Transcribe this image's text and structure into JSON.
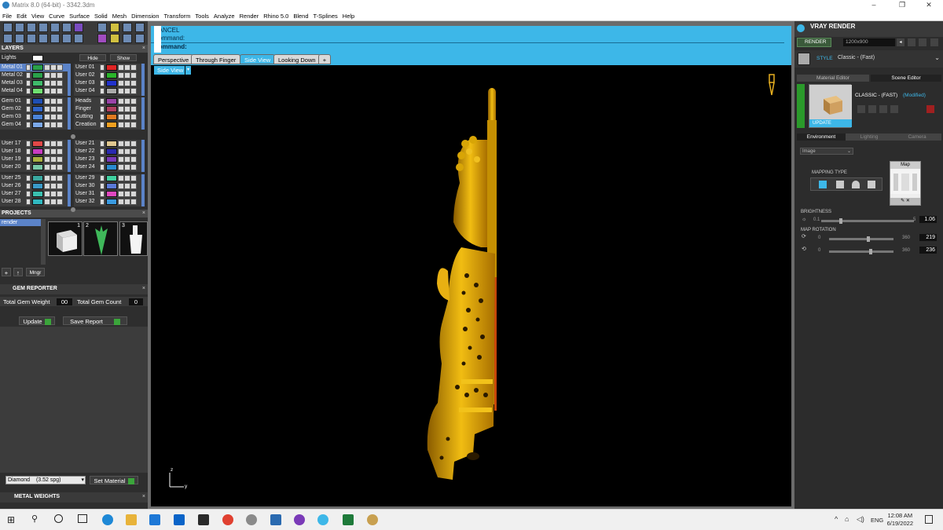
{
  "window": {
    "title": "Matrix 8.0 (64-bit) - 3342.3dm",
    "min": "–",
    "max": "❐",
    "close": "✕"
  },
  "menu": [
    "File",
    "Edit",
    "View",
    "Curve",
    "Surface",
    "Solid",
    "Mesh",
    "Dimension",
    "Transform",
    "Tools",
    "Analyze",
    "Render",
    "Rhino 5.0",
    "Blend",
    "T-Splines",
    "Help"
  ],
  "layers": {
    "header": "LAYERS",
    "lights": "Lights",
    "hide": "Hide",
    "show": "Show",
    "metals": [
      {
        "name": "Metal 01",
        "color": "#2aa04a"
      },
      {
        "name": "Metal 02",
        "color": "#2aa04a"
      },
      {
        "name": "Metal 03",
        "color": "#3fba6a"
      },
      {
        "name": "Metal 04",
        "color": "#6fe070"
      }
    ],
    "users_a": [
      {
        "name": "User 01",
        "color": "#e02424"
      },
      {
        "name": "User 02",
        "color": "#2ab52a"
      },
      {
        "name": "User 03",
        "color": "#2233cc"
      },
      {
        "name": "User 04",
        "color": "#aaaaaa"
      }
    ],
    "gems": [
      {
        "name": "Gem 01",
        "color": "#1f4fb5"
      },
      {
        "name": "Gem 02",
        "color": "#2f64c8"
      },
      {
        "name": "Gem 03",
        "color": "#4b84d8"
      },
      {
        "name": "Gem 04",
        "color": "#7ba8e8"
      }
    ],
    "misc": [
      {
        "name": "Heads",
        "color": "#9a44a8"
      },
      {
        "name": "Finger",
        "color": "#b04060"
      },
      {
        "name": "Cutting",
        "color": "#e07a20"
      },
      {
        "name": "Creation",
        "color": "#f0a020"
      }
    ],
    "users_b": [
      {
        "name": "User 17",
        "color": "#e04848"
      },
      {
        "name": "User 18",
        "color": "#c83cc0"
      },
      {
        "name": "User 19",
        "color": "#a8b040"
      },
      {
        "name": "User 20",
        "color": "#78c8a8"
      }
    ],
    "users_c": [
      {
        "name": "User 21",
        "color": "#e0c890"
      },
      {
        "name": "User 22",
        "color": "#2a2ab0"
      },
      {
        "name": "User 23",
        "color": "#7a3ab8"
      },
      {
        "name": "User 24",
        "color": "#2a8ad0"
      }
    ],
    "users_d": [
      {
        "name": "User 25",
        "color": "#3aa8a0"
      },
      {
        "name": "User 26",
        "color": "#3a9ac8"
      },
      {
        "name": "User 27",
        "color": "#3ac0b0"
      },
      {
        "name": "User 28",
        "color": "#30b8c0"
      }
    ],
    "users_e": [
      {
        "name": "User 29",
        "color": "#40d0a0"
      },
      {
        "name": "User 30",
        "color": "#5a7ad8"
      },
      {
        "name": "User 31",
        "color": "#e048c0"
      },
      {
        "name": "User 32",
        "color": "#3a9ae0"
      }
    ]
  },
  "projects": {
    "header": "PROJECTS",
    "item": "render",
    "thumbs": [
      "1",
      "2",
      "3"
    ],
    "mngr": "Mngr"
  },
  "gem_reporter": {
    "header": "GEM REPORTER",
    "total_weight_label": "Total Gem Weight",
    "total_weight_value": "00",
    "total_count_label": "Total Gem Count",
    "total_count_value": "0",
    "update": "Update",
    "save_report": "Save Report",
    "material": "Diamond",
    "sg": "(3.52 spg)",
    "set_material": "Set Material",
    "metal_weights": "METAL WEIGHTS"
  },
  "command": {
    "cancel": "CANCEL",
    "command1": "Command:",
    "command2": "Command:"
  },
  "viewport_tabs": [
    "Perspective",
    "Through Finger",
    "Side View",
    "Looking Down"
  ],
  "active_tab": "Side View",
  "viewport_label": "Side View",
  "axis": {
    "z": "z",
    "y": "y"
  },
  "vray": {
    "header": "VRAY RENDER",
    "render": "RENDER",
    "resolution": "1200x900",
    "style_label": "STYLE",
    "style": "Classic - (Fast)",
    "tab_material": "Material Editor",
    "tab_scene": "Scene Editor",
    "preset": "CLASSIC - (FAST)",
    "modified": "(Modified)",
    "update": "UPDATE",
    "env_tabs": [
      "Environment",
      "Lighting",
      "Camera"
    ],
    "env_type": "Image",
    "mapping_type": "MAPPING TYPE",
    "map": "Map",
    "brightness": "BRIGHTNESS",
    "brightness_min": "0.1",
    "brightness_max": "5",
    "brightness_val": "1.06",
    "brightness_level": 0.2,
    "map_rotation": "MAP ROTATION",
    "rot_min": "0",
    "rot_max": "360",
    "rot1": "219",
    "rot2": "236",
    "rot1_level": 0.61,
    "rot2_level": 0.66
  },
  "taskbar": {
    "lang": "ENG",
    "time": "12:08 AM",
    "date": "6/19/2022"
  },
  "colors": {
    "accent": "#3db7e8",
    "gold": "#e7b100",
    "panel": "#2e2e2e"
  }
}
